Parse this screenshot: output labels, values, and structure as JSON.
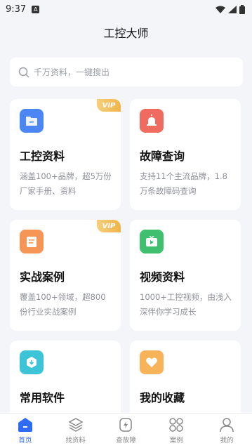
{
  "status_bar": {
    "time": "9:37",
    "notif_icon": "A"
  },
  "header": {
    "title": "工控大师"
  },
  "search": {
    "placeholder": "千万资料，一键搜出"
  },
  "cards": [
    {
      "title": "工控资料",
      "desc": "涵盖100+品牌，超5万份厂家手册、资料",
      "vip": "VIP",
      "icon": "folder-icon",
      "color": "#4c86f5"
    },
    {
      "title": "故障查询",
      "desc": "支持11个主流品牌，1.8万条故障码查询",
      "icon": "alarm-icon",
      "color": "#f06b5f"
    },
    {
      "title": "实战案例",
      "desc": "覆盖100+领域，超800份行业实战案例",
      "vip": "VIP",
      "icon": "document-icon",
      "color": "#f59556"
    },
    {
      "title": "视频资料",
      "desc": "1000+工控视频，由浅入深伴你学习成长",
      "icon": "tv-icon",
      "color": "#3fc06f"
    },
    {
      "title": "常用软件",
      "desc": "",
      "icon": "software-icon",
      "color": "#3dc4d6"
    },
    {
      "title": "我的收藏",
      "desc": "",
      "icon": "heart-icon",
      "color": "#f7b35a"
    }
  ],
  "tabbar": [
    {
      "label": "首页",
      "icon": "home-icon",
      "active": true
    },
    {
      "label": "找资料",
      "icon": "layers-icon"
    },
    {
      "label": "查故障",
      "icon": "fault-icon"
    },
    {
      "label": "案例",
      "icon": "grid-icon"
    },
    {
      "label": "我的",
      "icon": "user-icon"
    }
  ],
  "colors": {
    "accent": "#2f6bf6",
    "background": "#f4f5f9"
  }
}
